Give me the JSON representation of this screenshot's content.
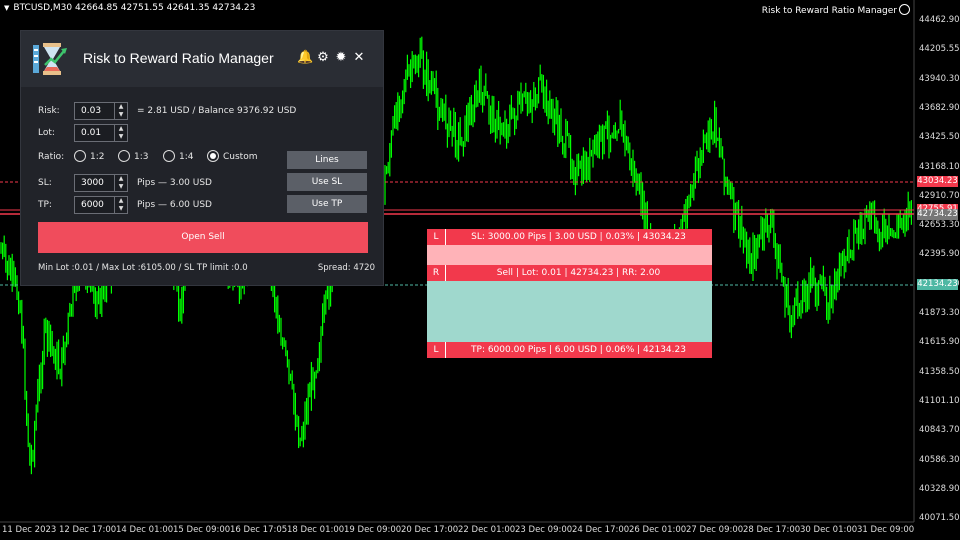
{
  "header": {
    "symbol_info": "BTCUSD,M30  42664.85 42751.55 42641.35 42734.23",
    "ea_name": "Risk to Reward Ratio Manager"
  },
  "price_axis": [
    "44462.90",
    "44205.55",
    "43940.30",
    "43682.90",
    "43425.50",
    "43168.10",
    "42910.70",
    "42653.30",
    "42395.90",
    "42138.50",
    "41873.30",
    "41615.90",
    "41358.50",
    "41101.10",
    "40843.70",
    "40586.30",
    "40328.90",
    "40071.50"
  ],
  "price_tags": {
    "sl": "43034.23",
    "entry_upper": "42755.91",
    "entry": "42734.23",
    "tp": "42134.23"
  },
  "time_axis": [
    "11 Dec 2023",
    "12 Dec 17:00",
    "14 Dec 01:00",
    "15 Dec 09:00",
    "16 Dec 17:05",
    "18 Dec 01:00",
    "19 Dec 09:00",
    "20 Dec 17:00",
    "22 Dec 01:00",
    "23 Dec 09:00",
    "24 Dec 17:00",
    "26 Dec 01:00",
    "27 Dec 09:00",
    "28 Dec 17:00",
    "30 Dec 01:00",
    "31 Dec 09:00"
  ],
  "colors": {
    "candle": "#00ff00",
    "sell_bar": "#f2394c",
    "sl_zone": "#ffb3b8",
    "tp_zone": "#9fd8cd",
    "button": "#5b5f67",
    "open_sell": "#f04c5c"
  },
  "panel": {
    "title": "Risk to Reward Ratio Manager",
    "icons": [
      "bell-icon",
      "gear-icon",
      "sun-icon",
      "close-icon"
    ],
    "risk_label": "Risk:",
    "risk_value": "0.03",
    "risk_info": "= 2.81 USD  /  Balance  9376.92 USD",
    "lot_label": "Lot:",
    "lot_value": "0.01",
    "ratio_label": "Ratio:",
    "ratios": [
      "1:2",
      "1:3",
      "1:4",
      "Custom"
    ],
    "ratio_selected": "Custom",
    "sl_label": "SL:",
    "sl_value": "3000",
    "sl_info": "Pips  —  3.00 USD",
    "tp_label": "TP:",
    "tp_value": "6000",
    "tp_info": "Pips  —  6.00 USD",
    "btn_lines": "Lines",
    "btn_use_sl": "Use SL",
    "btn_use_tp": "Use TP",
    "btn_open": "Open Sell",
    "footer_left": "Min Lot :0.01 / Max Lot :6105.00 / SL TP limit :0.0",
    "footer_right": "Spread:   4720"
  },
  "trade": {
    "sl_side": "L",
    "sl_text": "SL: 3000.00 Pips   |   3.00 USD   |   0.03%   |   43034.23",
    "entry_side": "R",
    "entry_text": "Sell   |   Lot: 0.01   |   42734.23   |   RR: 2.00",
    "tp_side": "L",
    "tp_text": "TP: 6000.00 Pips   |   6.00 USD   |   0.06%   |   42134.23"
  }
}
